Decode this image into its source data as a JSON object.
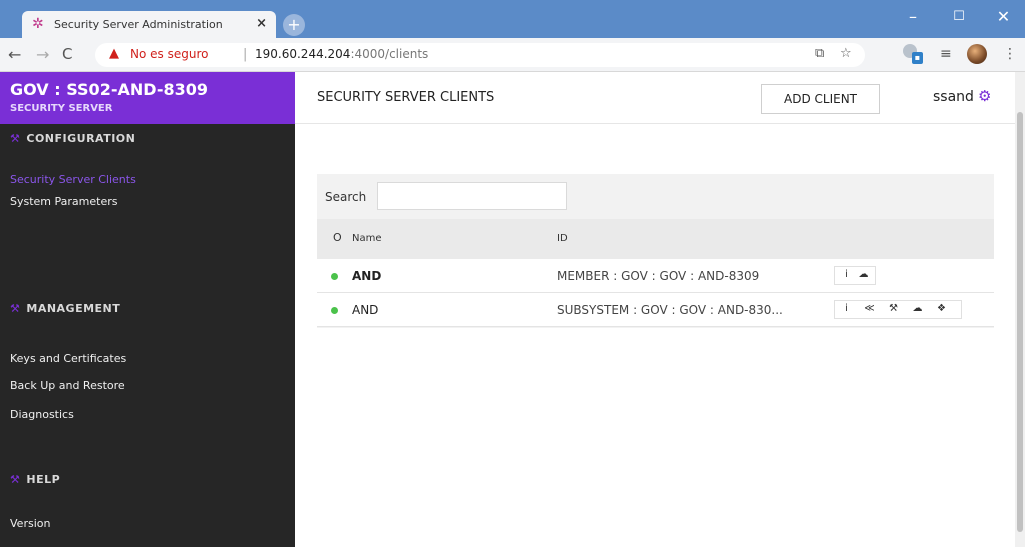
{
  "browser": {
    "tab_title": "Security Server Administration",
    "tab_close": "×",
    "new_tab": "+",
    "window_controls": {
      "minimize": "–",
      "maximize": "☐",
      "close": "✕"
    },
    "nav": {
      "back": "←",
      "forward": "→",
      "reload": "C"
    },
    "security_warning": "No es seguro",
    "separator": "|",
    "url_host": "190.60.244.204",
    "url_path": ":4000/clients",
    "icons": [
      "translate-icon",
      "star-icon",
      "extension-icon",
      "reading-list-icon",
      "profile-avatar-icon",
      "menu-icon"
    ]
  },
  "sidebar": {
    "server_name": "GOV : SS02-AND-8309",
    "server_type": "SECURITY SERVER",
    "sections": [
      {
        "heading": "CONFIGURATION",
        "items": [
          "Security Server Clients",
          "System Parameters"
        ]
      },
      {
        "heading": "MANAGEMENT",
        "items": [
          "Keys and Certificates",
          "Back Up and Restore",
          "Diagnostics"
        ]
      },
      {
        "heading": "HELP",
        "items": [
          "Version"
        ]
      }
    ],
    "active_item": "Security Server Clients"
  },
  "header": {
    "title": "SECURITY SERVER CLIENTS",
    "add_client_label": "ADD CLIENT",
    "username": "ssand"
  },
  "clients_table": {
    "search_label": "Search",
    "search_value": "",
    "columns": {
      "status": "O",
      "name": "Name",
      "id": "ID"
    },
    "rows": [
      {
        "status_color": "#4bc24b",
        "name": "AND",
        "id": "MEMBER : GOV : GOV : AND-8309",
        "actions": [
          {
            "icon": "info-icon",
            "glyph": "i"
          },
          {
            "icon": "cloud-icon",
            "glyph": "☁"
          }
        ]
      },
      {
        "status_color": "#4bc24b",
        "name": "AND",
        "id": "SUBSYSTEM : GOV : GOV : AND-830...",
        "actions": [
          {
            "icon": "info-icon",
            "glyph": "i"
          },
          {
            "icon": "share-icon",
            "glyph": "≪"
          },
          {
            "icon": "wrench-icon",
            "glyph": "⚒"
          },
          {
            "icon": "cloud-icon",
            "glyph": "☁"
          },
          {
            "icon": "gears-icon",
            "glyph": "❖"
          }
        ]
      }
    ]
  },
  "colors": {
    "brand": "#7a2fd6",
    "sidebar_bg": "#262626",
    "active_link": "#8b56ea",
    "titlebar": "#5b8bc8",
    "warning": "#d0211c",
    "status_ok": "#4bc24b"
  }
}
